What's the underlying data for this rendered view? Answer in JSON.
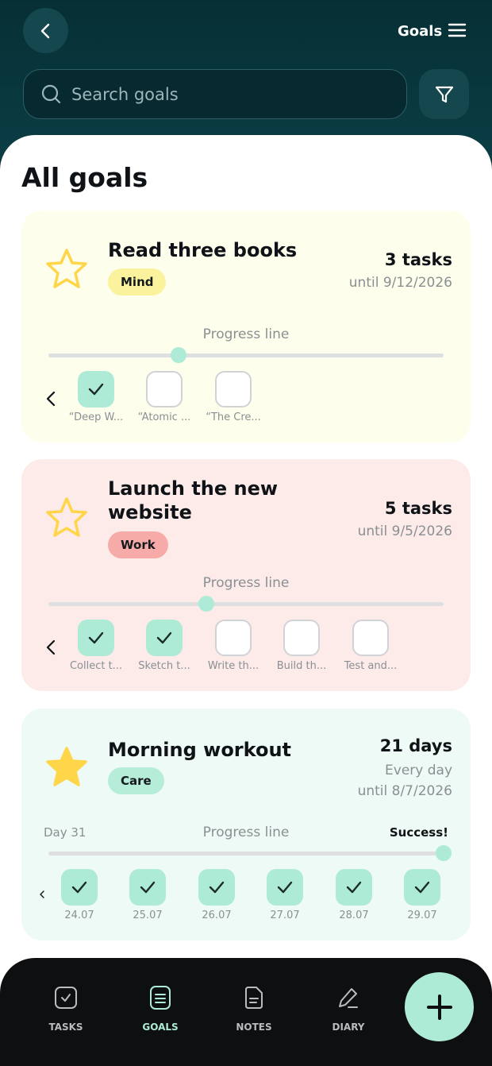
{
  "header": {
    "title": "Goals",
    "search_placeholder": "Search goals"
  },
  "page_title": "All goals",
  "goals": [
    {
      "title": "Read three books",
      "tag": "Mind",
      "count": "3 tasks",
      "until": "until 9/12/2026",
      "progress_label": "Progress line",
      "progress": 0.33,
      "tasks": [
        {
          "label": "“Deep W...",
          "checked": true
        },
        {
          "label": "“Atomic ...",
          "checked": false
        },
        {
          "label": "“The Cre...",
          "checked": false
        }
      ]
    },
    {
      "title_line1": "Launch the new",
      "title_line2": "website",
      "tag": "Work",
      "count": "5 tasks",
      "until": "until 9/5/2026",
      "progress_label": "Progress line",
      "progress": 0.4,
      "tasks": [
        {
          "label": "Collect t...",
          "checked": true
        },
        {
          "label": "Sketch t...",
          "checked": true
        },
        {
          "label": "Write th...",
          "checked": false
        },
        {
          "label": "Build th...",
          "checked": false
        },
        {
          "label": "Test and...",
          "checked": false
        }
      ]
    },
    {
      "title": "Morning workout",
      "tag": "Care",
      "count": "21 days",
      "frequency": "Every day",
      "until": "until 8/7/2026",
      "day_label": "Day 31",
      "progress_label": "Progress line",
      "success_label": "Success!",
      "progress": 1.0,
      "days": [
        {
          "label": "24.07",
          "checked": true
        },
        {
          "label": "25.07",
          "checked": true
        },
        {
          "label": "26.07",
          "checked": true
        },
        {
          "label": "27.07",
          "checked": true
        },
        {
          "label": "28.07",
          "checked": true
        },
        {
          "label": "29.07",
          "checked": true
        }
      ]
    }
  ],
  "nav": {
    "tasks": "TASKS",
    "goals": "GOALS",
    "notes": "NOTES",
    "diary": "DIARY"
  },
  "colors": {
    "accent": "#AEEBD7",
    "header_bg": "#06343A",
    "mind_bg": "#FEFEEC",
    "work_bg": "#FDEBEA",
    "care_bg": "#EEFAF5",
    "star_yellow": "#FFD54A"
  }
}
